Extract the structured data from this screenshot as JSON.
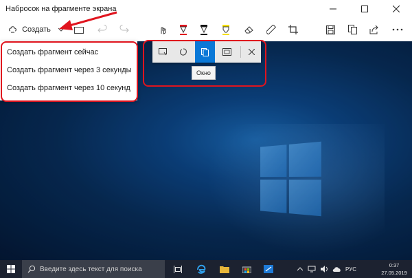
{
  "window": {
    "title": "Набросок на фрагменте экрана"
  },
  "toolbar": {
    "create_label": "Создать",
    "icons": [
      "undo-icon",
      "redo-icon",
      "touch-writing-icon",
      "ballpoint-pen-icon",
      "pencil-icon",
      "highlighter-icon",
      "eraser-icon",
      "ruler-icon",
      "crop-icon",
      "save-icon",
      "copy-icon",
      "share-icon",
      "more-icon"
    ],
    "pen_colors": {
      "ballpoint": "#e0141e",
      "pencil": "#111111",
      "highlighter": "#f5e000"
    }
  },
  "dropdown": {
    "items": [
      "Создать фрагмент сейчас",
      "Создать фрагмент через 3 секунды",
      "Создать фрагмент через 10 секунд"
    ]
  },
  "snip_modes": {
    "items": [
      "rectangular-snip-icon",
      "freeform-snip-icon",
      "window-snip-icon",
      "fullscreen-snip-icon"
    ],
    "selected": 2,
    "tooltip": "Окно"
  },
  "taskbar": {
    "search_placeholder": "Введите здесь текст для поиска",
    "language": "РУС",
    "time": "0:37",
    "date": "27.05.2019"
  },
  "colors": {
    "accent": "#0a78d7",
    "annotation": "#e0141e",
    "taskbar": "#1c2230"
  }
}
